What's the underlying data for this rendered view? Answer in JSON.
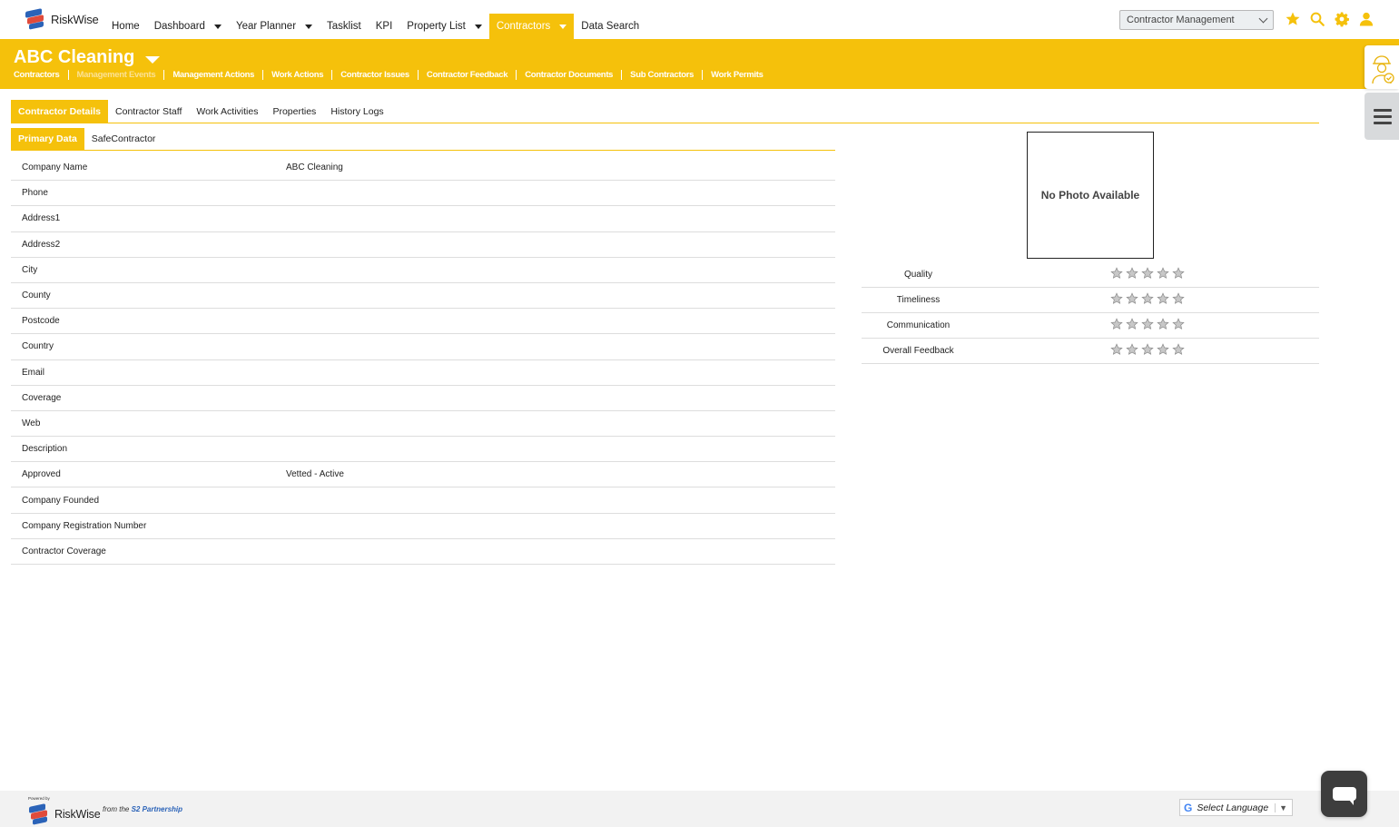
{
  "brand": {
    "logo_text": "RiskWise"
  },
  "nav": {
    "items": [
      {
        "label": "Home",
        "dropdown": false,
        "active": false
      },
      {
        "label": "Dashboard",
        "dropdown": true,
        "active": false
      },
      {
        "label": "Year Planner",
        "dropdown": true,
        "active": false
      },
      {
        "label": "Tasklist",
        "dropdown": false,
        "active": false
      },
      {
        "label": "KPI",
        "dropdown": false,
        "active": false
      },
      {
        "label": "Property List",
        "dropdown": true,
        "active": false
      },
      {
        "label": "Contractors",
        "dropdown": true,
        "active": true
      },
      {
        "label": "Data Search",
        "dropdown": false,
        "active": false
      }
    ],
    "module_select": "Contractor Management",
    "icons": [
      "star-icon",
      "search-icon",
      "gear-icon",
      "user-icon"
    ],
    "accent_color": "#f5c10b"
  },
  "header": {
    "title": "ABC Cleaning",
    "subnav": [
      {
        "label": "Contractors",
        "dim": false
      },
      {
        "label": "Management Events",
        "dim": true
      },
      {
        "label": "Management Actions",
        "dim": false
      },
      {
        "label": "Work Actions",
        "dim": false
      },
      {
        "label": "Contractor Issues",
        "dim": false
      },
      {
        "label": "Contractor Feedback",
        "dim": false
      },
      {
        "label": "Contractor Documents",
        "dim": false
      },
      {
        "label": "Sub Contractors",
        "dim": false
      },
      {
        "label": "Work Permits",
        "dim": false
      }
    ]
  },
  "tabs": {
    "primary": [
      {
        "label": "Contractor Details",
        "active": true
      },
      {
        "label": "Contractor Staff",
        "active": false
      },
      {
        "label": "Work Activities",
        "active": false
      },
      {
        "label": "Properties",
        "active": false
      },
      {
        "label": "History Logs",
        "active": false
      }
    ],
    "secondary": [
      {
        "label": "Primary Data",
        "active": true
      },
      {
        "label": "SafeContractor",
        "active": false
      }
    ]
  },
  "details": [
    {
      "label": "Company Name",
      "value": "ABC Cleaning"
    },
    {
      "label": "Phone",
      "value": ""
    },
    {
      "label": "Address1",
      "value": ""
    },
    {
      "label": "Address2",
      "value": ""
    },
    {
      "label": "City",
      "value": ""
    },
    {
      "label": "County",
      "value": ""
    },
    {
      "label": "Postcode",
      "value": ""
    },
    {
      "label": "Country",
      "value": ""
    },
    {
      "label": "Email",
      "value": ""
    },
    {
      "label": "Coverage",
      "value": ""
    },
    {
      "label": "Web",
      "value": ""
    },
    {
      "label": "Description",
      "value": ""
    },
    {
      "label": "Approved",
      "value": "Vetted - Active"
    },
    {
      "label": "Company Founded",
      "value": ""
    },
    {
      "label": "Company Registration Number",
      "value": ""
    },
    {
      "label": "Contractor Coverage",
      "value": ""
    }
  ],
  "photo": {
    "placeholder": "No Photo Available"
  },
  "ratings": [
    {
      "label": "Quality",
      "stars": 0,
      "max": 5
    },
    {
      "label": "Timeliness",
      "stars": 0,
      "max": 5
    },
    {
      "label": "Communication",
      "stars": 0,
      "max": 5
    },
    {
      "label": "Overall Feedback",
      "stars": 0,
      "max": 5
    }
  ],
  "footer": {
    "powered_by": "Powered by",
    "logo_text": "RiskWise",
    "from_prefix": "from the",
    "partner": "S2 Partnership",
    "language_select": "Select Language"
  }
}
